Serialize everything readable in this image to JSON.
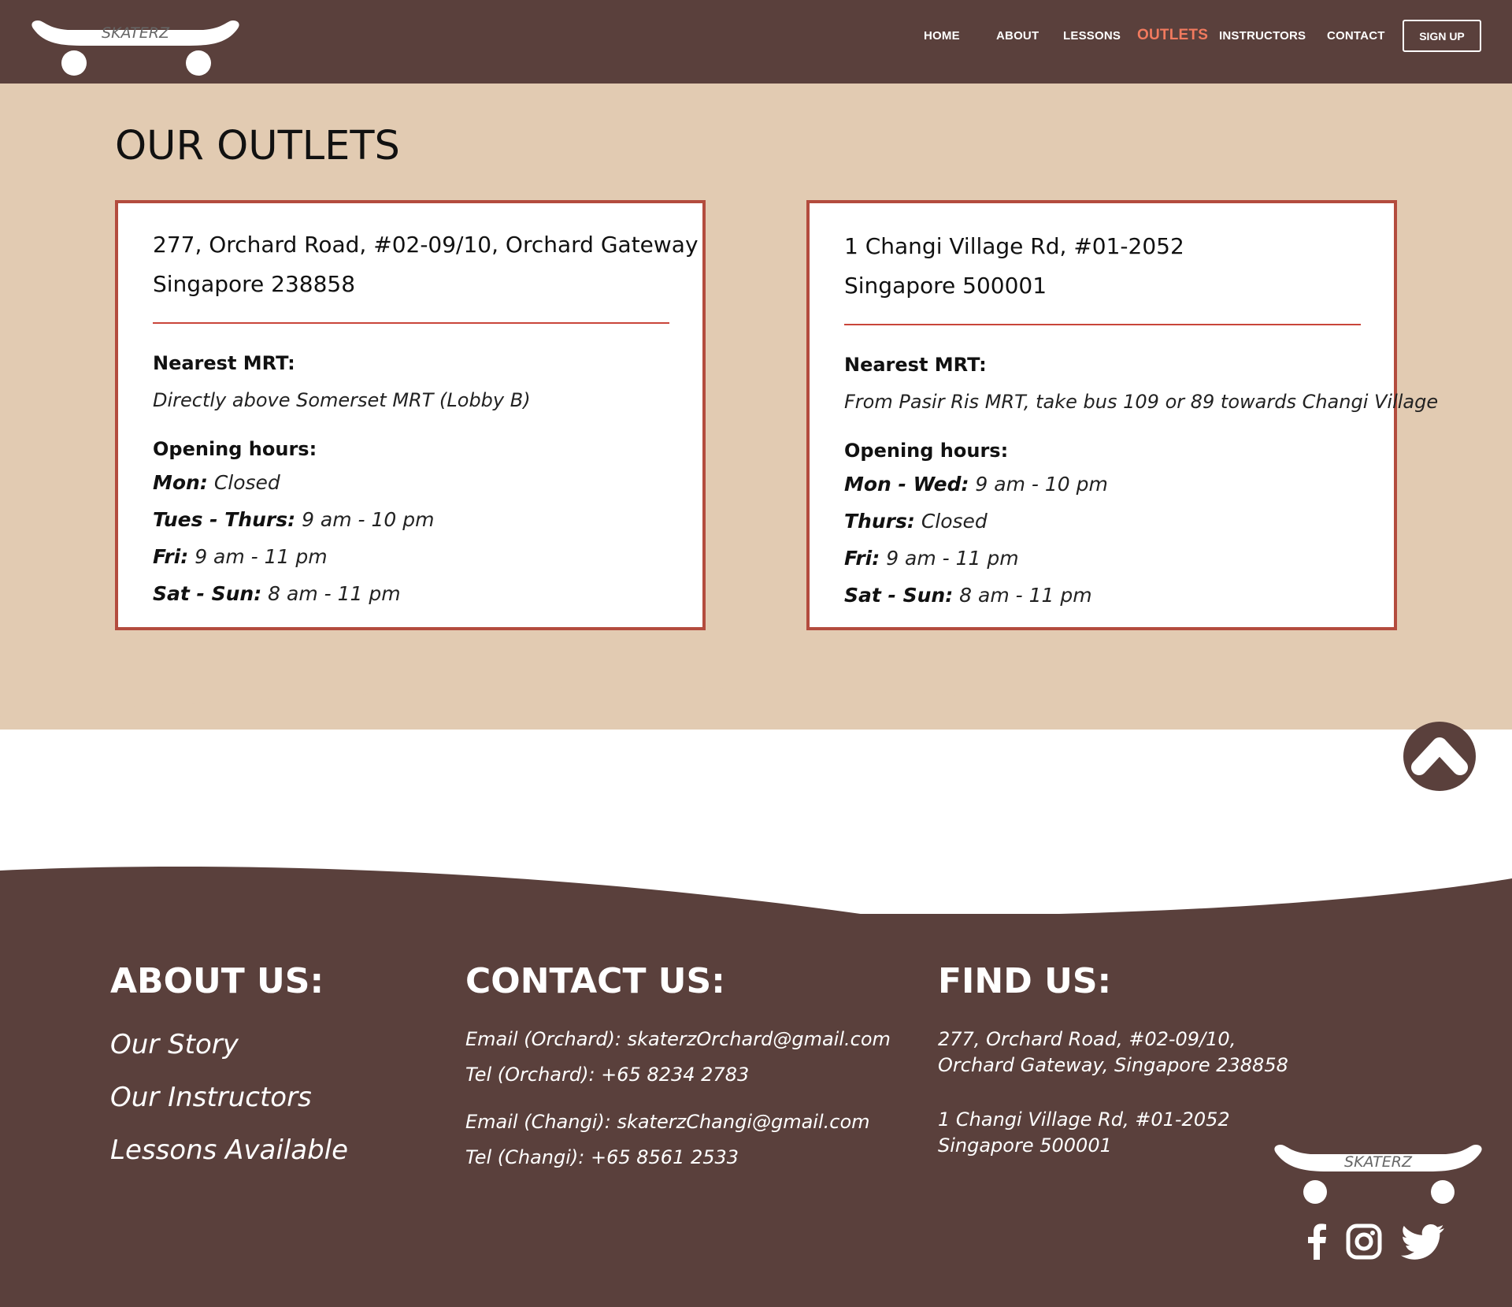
{
  "header": {
    "logo_text": "SKATERZ",
    "nav": [
      {
        "label": "HOME"
      },
      {
        "label": "ABOUT"
      },
      {
        "label": "LESSONS"
      },
      {
        "label": "OUTLETS",
        "active": true
      },
      {
        "label": "INSTRUCTORS"
      },
      {
        "label": "CONTACT"
      }
    ],
    "signup_label": "SIGN UP"
  },
  "main": {
    "title": "OUR OUTLETS",
    "outlets": [
      {
        "address_line1": "277, Orchard Road, #02-09/10, Orchard Gateway",
        "address_line2": "Singapore 238858",
        "mrt_label": "Nearest MRT:",
        "mrt_text": "Directly above Somerset MRT (Lobby B)",
        "hours_label": "Opening hours:",
        "hours": [
          {
            "day": "Mon:",
            "time": "Closed"
          },
          {
            "day": "Tues - Thurs:",
            "time": "9 am - 10 pm"
          },
          {
            "day": "Fri:",
            "time": "9 am - 11 pm"
          },
          {
            "day": "Sat - Sun:",
            "time": "8 am - 11 pm"
          }
        ]
      },
      {
        "address_line1": "1 Changi Village Rd, #01-2052",
        "address_line2": "Singapore 500001",
        "mrt_label": "Nearest MRT:",
        "mrt_text": "From Pasir Ris MRT, take bus 109 or 89 towards Changi Village",
        "hours_label": "Opening hours:",
        "hours": [
          {
            "day": "Mon - Wed:",
            "time": "9 am - 10 pm"
          },
          {
            "day": "Thurs:",
            "time": "Closed"
          },
          {
            "day": "Fri:",
            "time": "9 am - 11 pm"
          },
          {
            "day": "Sat - Sun:",
            "time": "8 am - 11 pm"
          }
        ]
      }
    ]
  },
  "back_to_top": {
    "icon": "chevron-up-icon"
  },
  "footer": {
    "about": {
      "heading": "ABOUT US:",
      "links": [
        "Our Story",
        "Our Instructors",
        "Lessons Available"
      ]
    },
    "contact": {
      "heading": "CONTACT US:",
      "email_orchard": "Email (Orchard): skaterzOrchard@gmail.com",
      "tel_orchard": "Tel (Orchard):  +65 8234 2783",
      "email_changi": "Email (Changi): skaterzChangi@gmail.com",
      "tel_changi": "Tel (Changi):   +65 8561 2533"
    },
    "find": {
      "heading": "FIND US:",
      "orchard_line1": "277, Orchard Road, #02-09/10,",
      "orchard_line2": "Orchard Gateway, Singapore 238858",
      "changi_line1": "1 Changi Village Rd, #01-2052",
      "changi_line2": "Singapore 500001"
    },
    "logo_text": "SKATERZ",
    "social": [
      "facebook-icon",
      "instagram-icon",
      "twitter-icon"
    ]
  },
  "colors": {
    "brand_brown": "#5a403c",
    "sand": "#e2cbb2",
    "accent": "#f27a5e",
    "card_border": "#b34c3e"
  }
}
